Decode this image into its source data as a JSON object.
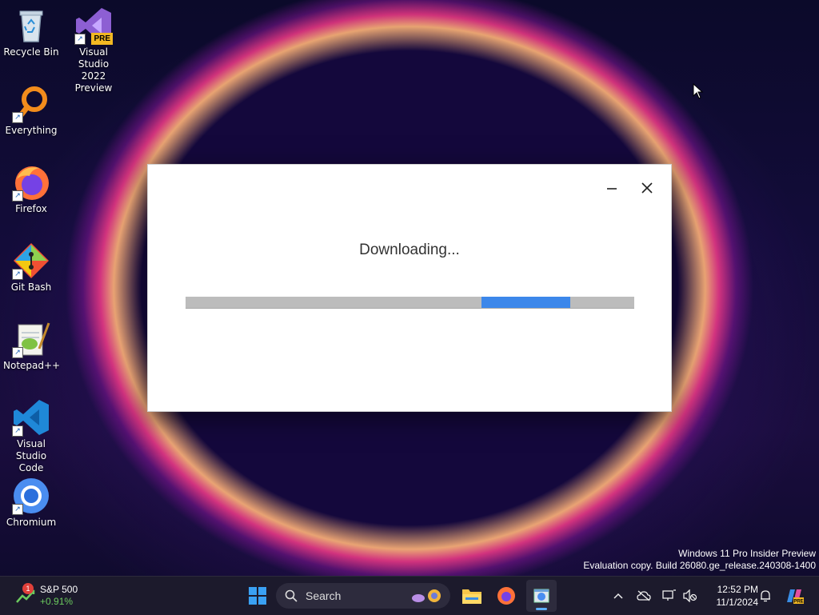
{
  "desktop": {
    "icons": [
      {
        "label": "Recycle Bin",
        "icon": "recycle-bin-icon"
      },
      {
        "label": "Visual Studio 2022 Preview",
        "icon": "visual-studio-icon",
        "badge": "PRE"
      },
      {
        "label": "Everything",
        "icon": "everything-search-icon"
      },
      {
        "label": "Firefox",
        "icon": "firefox-icon"
      },
      {
        "label": "Git Bash",
        "icon": "git-bash-icon"
      },
      {
        "label": "Notepad++",
        "icon": "notepad-plus-plus-icon"
      },
      {
        "label": "Visual Studio Code",
        "icon": "vscode-icon"
      },
      {
        "label": "Chromium",
        "icon": "chromium-icon"
      }
    ],
    "watermark": {
      "line1": "Windows 11 Pro Insider Preview",
      "line2": "Evaluation copy. Build 26080.ge_release.240308-1400"
    }
  },
  "dialog": {
    "message": "Downloading...",
    "progress": 0.86,
    "minimize_icon": "minimize-icon",
    "close_icon": "close-icon"
  },
  "taskbar": {
    "widget": {
      "name": "S&P 500",
      "change": "+0.91%",
      "notification_count": "1"
    },
    "search_placeholder": "Search",
    "time": "12:52 PM",
    "date": "11/1/2024",
    "colors": {
      "accent": "#3c87ea",
      "positive": "#6ccb5f",
      "badge": "#e0403a"
    }
  }
}
